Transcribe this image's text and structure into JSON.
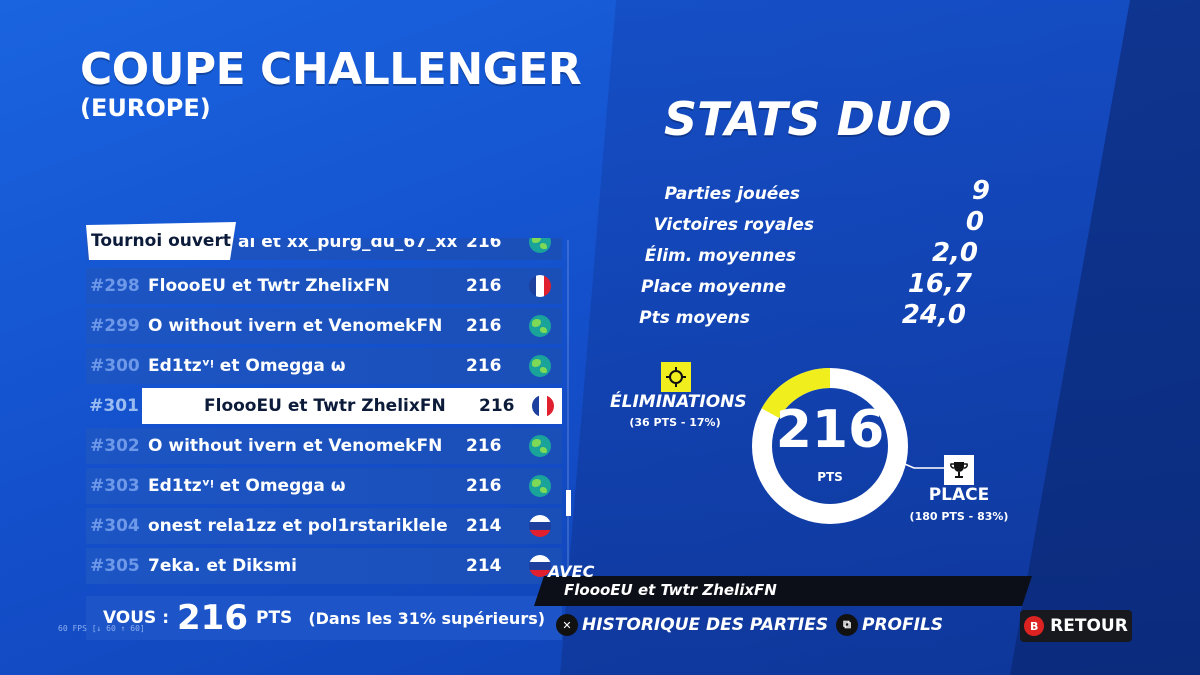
{
  "header": {
    "title": "COUPE CHALLENGER",
    "subtitle": "(EUROPE)",
    "tab": "Tournoi ouvert"
  },
  "leaderboard": {
    "partial_row": {
      "name": "al et xx_purg_du_67_xx",
      "points": "216",
      "flag": "globe"
    },
    "rows": [
      {
        "rank": "#298",
        "name": "FloooEU et Twtr ZhelixFN",
        "points": "216",
        "flag": "fr"
      },
      {
        "rank": "#299",
        "name": "O without ivern et VenomekFN",
        "points": "216",
        "flag": "globe"
      },
      {
        "rank": "#300",
        "name": "Ed1tzᵛᵎ et Omegga ω",
        "points": "216",
        "flag": "globe"
      },
      {
        "rank": "#301",
        "name": "FloooEU et Twtr ZhelixFN",
        "points": "216",
        "flag": "fr"
      },
      {
        "rank": "#302",
        "name": "O without ivern et VenomekFN",
        "points": "216",
        "flag": "globe"
      },
      {
        "rank": "#303",
        "name": "Ed1tzᵛᵎ et Omegga ω",
        "points": "216",
        "flag": "globe"
      },
      {
        "rank": "#304",
        "name": "onest rela1zz et pol1rstariklele",
        "points": "214",
        "flag": "ru"
      },
      {
        "rank": "#305",
        "name": "7eka. et Diksmi",
        "points": "214",
        "flag": "ru"
      }
    ],
    "selected_index": 3
  },
  "you": {
    "label": "VOUS :",
    "value": "216",
    "unit": "PTS",
    "percentile": "(Dans les 31% supérieurs)"
  },
  "fps": "60 FPS [↓ 60 ↑ 60]",
  "stats": {
    "title": "STATS DUO",
    "items": [
      {
        "label": "Parties jouées",
        "value": "9"
      },
      {
        "label": "Victoires royales",
        "value": "0"
      },
      {
        "label": "Élim. moyennes",
        "value": "2,0"
      },
      {
        "label": "Place moyenne",
        "value": "16,7"
      },
      {
        "label": "Pts moyens",
        "value": "24,0"
      }
    ]
  },
  "points_breakdown": {
    "total": "216",
    "unit": "PTS",
    "elim_label": "ÉLIMINATIONS",
    "elim_sub": "(36 PTS - 17%)",
    "elim_fraction": 0.17,
    "place_label": "PLACE",
    "place_sub": "(180 PTS - 83%)",
    "place_fraction": 0.83
  },
  "partner": {
    "label": "AVEC",
    "name": "FloooEU et Twtr ZhelixFN"
  },
  "footer": {
    "history_label": "HISTORIQUE DES PARTIES",
    "profiles_label": "PROFILS",
    "back_label": "RETOUR"
  },
  "colors": {
    "elim": "#f0ee1c",
    "place": "#ffffff",
    "back_button": "#d22222"
  }
}
